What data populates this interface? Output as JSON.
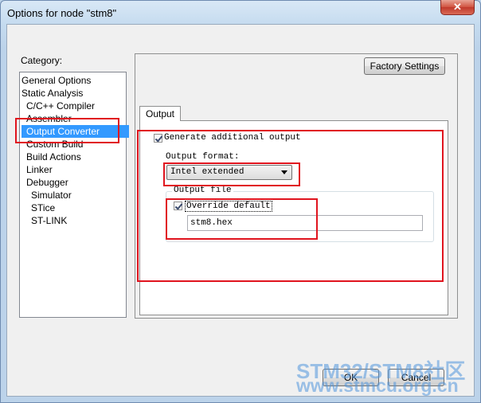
{
  "window": {
    "title": "Options for node \"stm8\"",
    "close_glyph": "✕"
  },
  "category": {
    "label": "Category:",
    "items": [
      {
        "label": "General Options"
      },
      {
        "label": "Static Analysis"
      },
      {
        "label": "C/C++ Compiler"
      },
      {
        "label": "Assembler"
      },
      {
        "label": "Output Converter",
        "selected": true
      },
      {
        "label": "Custom Build"
      },
      {
        "label": "Build Actions"
      },
      {
        "label": "Linker"
      },
      {
        "label": "Debugger"
      },
      {
        "label": "Simulator"
      },
      {
        "label": "STice"
      },
      {
        "label": "ST-LINK"
      }
    ]
  },
  "factory_settings_label": "Factory Settings",
  "tabs": [
    {
      "label": "Output",
      "active": true
    }
  ],
  "output": {
    "generate_label": "Generate additional output",
    "generate_checked": true,
    "format_label": "Output format:",
    "format_value": "Intel extended",
    "file_group_label": "Output file",
    "override_label": "Override default",
    "override_checked": true,
    "file_value": "stm8.hex"
  },
  "buttons": {
    "ok": "OK",
    "cancel": "Cancel"
  },
  "watermark": {
    "line1": "STM32/STM8社区",
    "line2": "www.stmcu.org.cn"
  },
  "colors": {
    "highlight_red": "#e0141e",
    "selection_blue": "#3399ff"
  }
}
